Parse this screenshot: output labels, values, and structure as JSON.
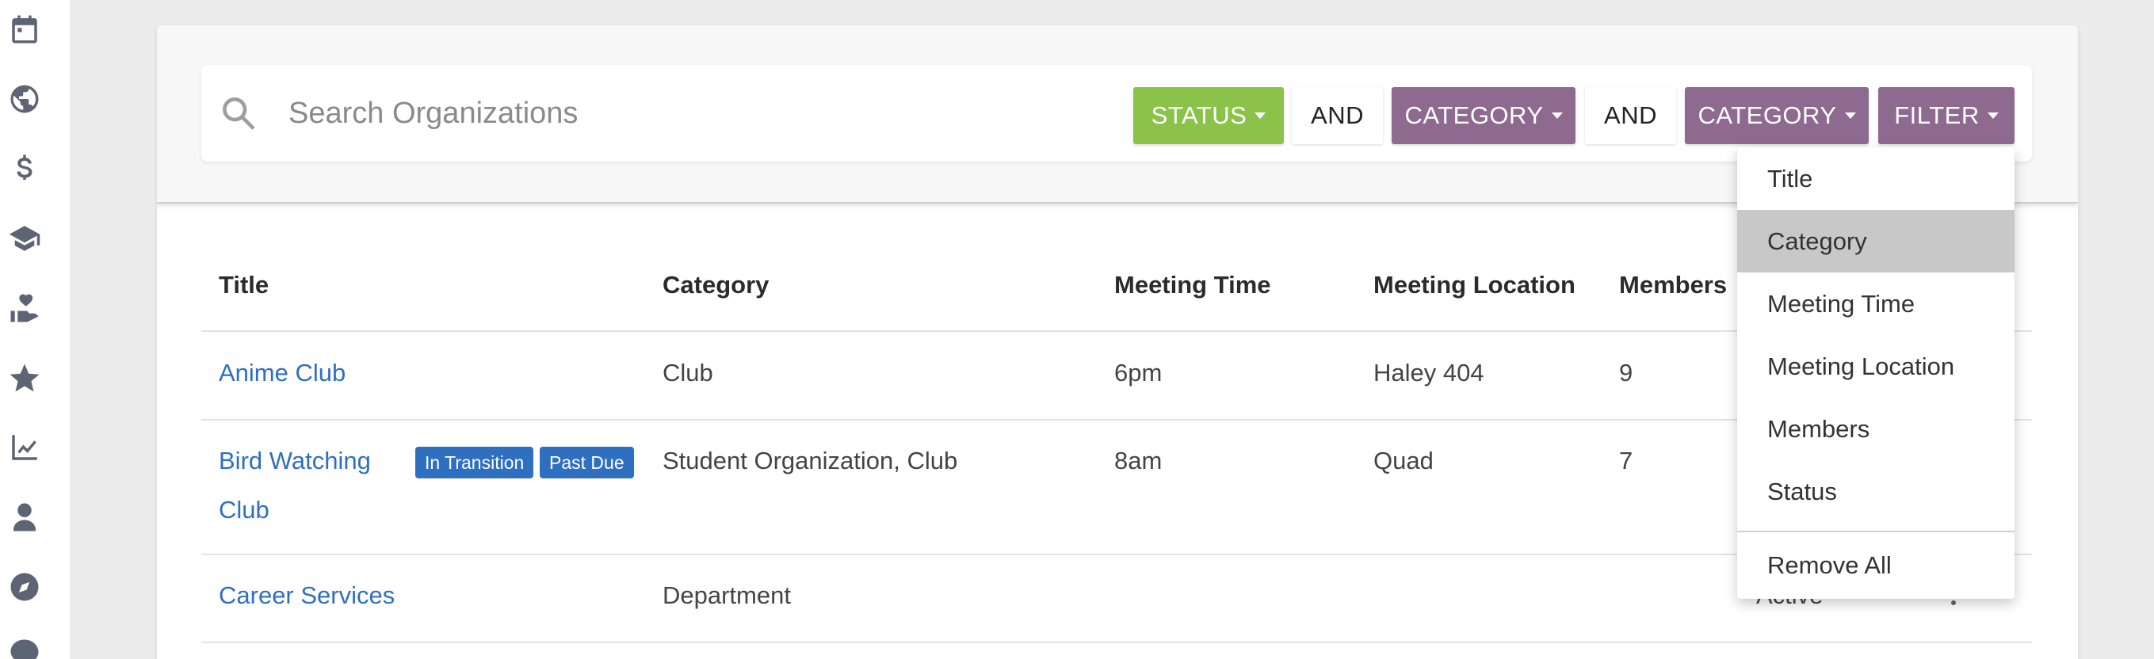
{
  "search": {
    "placeholder": "Search Organizations",
    "value": ""
  },
  "filters": {
    "chips": [
      {
        "label": "STATUS",
        "color": "#8bc34a"
      },
      {
        "label": "AND"
      },
      {
        "label": "CATEGORY",
        "color": "#8e6a91"
      },
      {
        "label": "AND"
      },
      {
        "label": "CATEGORY",
        "color": "#8e6a91"
      },
      {
        "label": "FILTER",
        "color": "#8e6a91"
      }
    ]
  },
  "sidebar": {
    "icons": [
      "calendar-icon",
      "globe-icon",
      "dollar-icon",
      "graduation-cap-icon",
      "hand-heart-icon",
      "star-icon",
      "chart-line-icon",
      "user-icon",
      "compass-icon",
      "sms-icon"
    ]
  },
  "table": {
    "columns": [
      "Title",
      "Category",
      "Meeting Time",
      "Meeting Location",
      "Members"
    ],
    "rows": [
      {
        "title": "Anime Club",
        "badges": [],
        "category": "Club",
        "meeting_time": "6pm",
        "meeting_location": "Haley 404",
        "members": "9",
        "status": ""
      },
      {
        "title_line1": "Bird Watching",
        "title_line2": "Club",
        "badges": [
          "In Transition",
          "Past Due"
        ],
        "category": "Student Organization, Club",
        "meeting_time": "8am",
        "meeting_location": "Quad",
        "members": "7",
        "status": ""
      },
      {
        "title": "Career Services",
        "badges": [],
        "category": "Department",
        "meeting_time": "",
        "meeting_location": "",
        "members": "",
        "status": "Active"
      }
    ]
  },
  "dropdown": {
    "items": [
      "Title",
      "Category",
      "Meeting Time",
      "Meeting Location",
      "Members",
      "Status"
    ],
    "selected": "Category",
    "remove_all": "Remove All"
  },
  "colors": {
    "link": "#2f6fc0",
    "badge": "#2f6fc0",
    "status_chip": "#8bc34a",
    "category_chip": "#8e6a91"
  }
}
